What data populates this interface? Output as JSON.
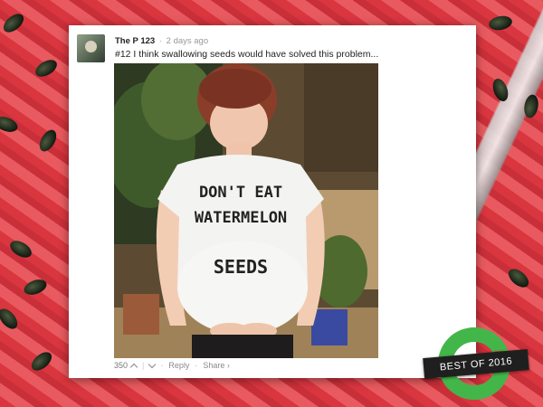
{
  "post": {
    "username": "The P 123",
    "separator": "·",
    "timestamp": "2 days ago",
    "comment_text": "#12 I think swallowing seeds would have solved this problem...",
    "shirt_text": [
      "DON'T EAT",
      "WATERMELON",
      "SEEDS"
    ]
  },
  "actions": {
    "vote_count": "350",
    "reply_label": "Reply",
    "share_label": "Share ›",
    "separator": "·"
  },
  "badge": {
    "label": "BEST OF 2016",
    "ring_color": "#43b649",
    "ribbon_color": "#1f1f1f"
  },
  "icons": {
    "upvote": "chevron-up-icon",
    "downvote": "chevron-down-icon"
  }
}
